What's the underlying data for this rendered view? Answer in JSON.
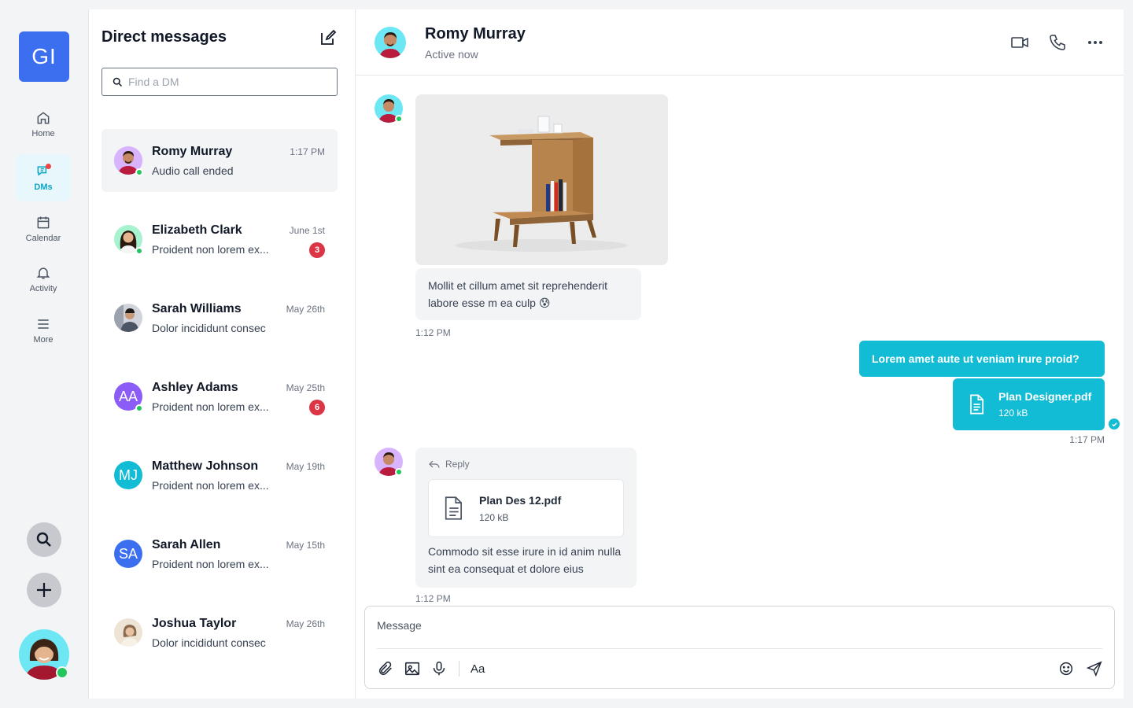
{
  "workspace": {
    "initials": "GI"
  },
  "nav": [
    {
      "label": "Home",
      "icon": "home-icon"
    },
    {
      "label": "DMs",
      "icon": "chat-icon"
    },
    {
      "label": "Calendar",
      "icon": "calendar-icon"
    },
    {
      "label": "Activity",
      "icon": "bell-icon"
    },
    {
      "label": "More",
      "icon": "menu-icon"
    }
  ],
  "dm_panel": {
    "title": "Direct messages",
    "search_placeholder": "Find a DM",
    "items": [
      {
        "name": "Romy Murray",
        "time": "1:17 PM",
        "preview": "Audio call ended",
        "badge": "",
        "initials": "",
        "color": "#d8b4fe"
      },
      {
        "name": "Elizabeth Clark",
        "time": "June 1st",
        "preview": "Proident non lorem ex...",
        "badge": "3",
        "initials": "",
        "color": "#a7f3d0"
      },
      {
        "name": "Sarah Williams",
        "time": "May 26th",
        "preview": "Dolor incididunt consec",
        "badge": "",
        "initials": "",
        "color": "#e5e7eb"
      },
      {
        "name": "Ashley Adams",
        "time": "May 25th",
        "preview": "Proident non lorem ex...",
        "badge": "6",
        "initials": "AA",
        "color": "#8b5cf6"
      },
      {
        "name": "Matthew Johnson",
        "time": "May 19th",
        "preview": "Proident non lorem ex...",
        "badge": "",
        "initials": "MJ",
        "color": "#12bcd4"
      },
      {
        "name": "Sarah Allen",
        "time": "May 15th",
        "preview": "Proident non lorem ex...",
        "badge": "",
        "initials": "SA",
        "color": "#3b6ff0"
      },
      {
        "name": "Joshua Taylor",
        "time": "May 26th",
        "preview": "Dolor incididunt consec",
        "badge": "",
        "initials": "",
        "color": "#e7dccd"
      }
    ]
  },
  "chat": {
    "name": "Romy Murray",
    "status": "Active now",
    "msg1_text": "Mollit et cillum amet sit reprehenderit labore esse m ea culp 😰",
    "msg1_time": "1:12 PM",
    "out_text": "Lorem amet aute ut veniam irure proid?",
    "out_file_name": "Plan Designer.pdf",
    "out_file_size": "120 kB",
    "out_time": "1:17 PM",
    "reply_label": "Reply",
    "reply_file_name": "Plan Des 12.pdf",
    "reply_file_size": "120 kB",
    "reply_text": "Commodo sit esse irure in id anim nulla sint ea consequat et dolore eius",
    "reply_time": "1:12 PM",
    "composer_placeholder": "Message",
    "font_button": "Aa"
  },
  "colors": {
    "accent": "#12bcd4",
    "brand": "#3b6ff0",
    "badge": "#dc3545",
    "online": "#22c55e"
  }
}
